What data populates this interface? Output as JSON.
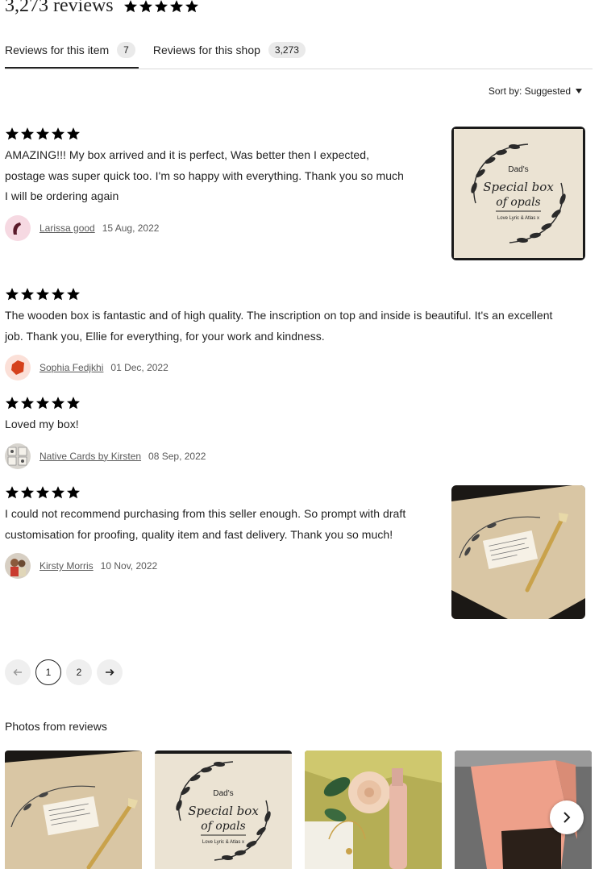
{
  "header": {
    "review_count": "3,273 reviews",
    "rating": 5
  },
  "tabs": [
    {
      "label": "Reviews for this item",
      "count": "7"
    },
    {
      "label": "Reviews for this shop",
      "count": "3,273"
    }
  ],
  "sort": {
    "label": "Sort by: Suggested"
  },
  "reviews": [
    {
      "stars": 5,
      "text": "AMAZING!!! My box arrived and it is perfect, Was better then I expected, postage was super quick too. I'm so happy with everything. Thank you so much I will be ordering again",
      "author": "Larissa good",
      "date": "15 Aug, 2022"
    },
    {
      "stars": 5,
      "text": "The wooden box is fantastic and of high quality. The inscription on top and inside is beautiful. It's an excellent job. Thank you, Ellie for everything, for your work and kindness.",
      "author": "Sophia Fedjkhi",
      "date": "01 Dec, 2022"
    },
    {
      "stars": 5,
      "text": "Loved my box!",
      "author": "Native Cards by Kirsten",
      "date": "08 Sep, 2022"
    },
    {
      "stars": 5,
      "text": "I could not recommend purchasing from this seller enough. So prompt with draft customisation for proofing, quality item and fast delivery. Thank you so much!",
      "author": "Kirsty Morris",
      "date": "10 Nov, 2022"
    }
  ],
  "engraving": {
    "line1": "Dad's",
    "line2": "Special box",
    "line3": "of opals",
    "line4": "Love Lyric & Atlas x"
  },
  "pagination": {
    "prev_icon": "arrow-left-icon",
    "pages": [
      "1",
      "2"
    ],
    "current": "1",
    "next_icon": "arrow-right-icon"
  },
  "photos": {
    "title": "Photos from reviews",
    "next_icon": "chevron-right-icon"
  },
  "colors": {
    "text": "#222222",
    "muted": "#595959",
    "badge": "#eaeaea",
    "wood": "#e9dcc6"
  }
}
